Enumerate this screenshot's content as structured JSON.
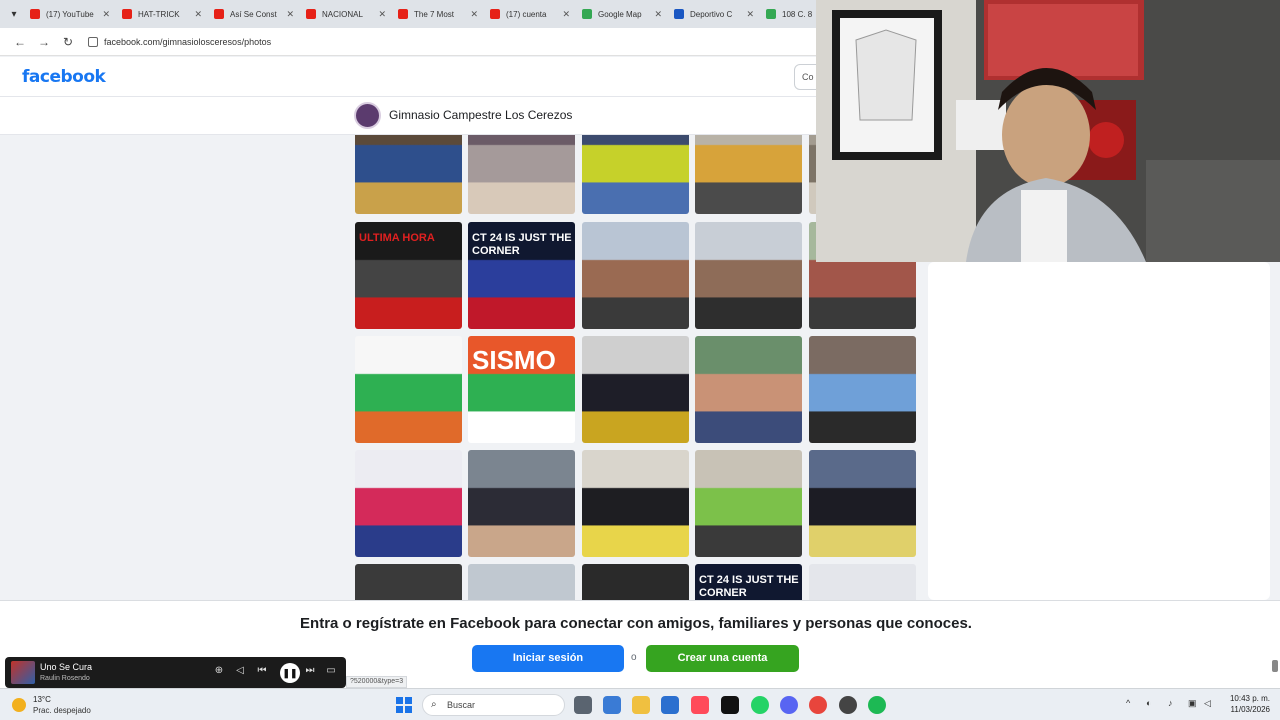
{
  "browser": {
    "tabs": [
      {
        "label": "(17) YouTube",
        "color": "#e62117"
      },
      {
        "label": "HAT-TRICK",
        "color": "#e62117"
      },
      {
        "label": "Así Se Const",
        "color": "#e62117"
      },
      {
        "label": "NACIONAL",
        "color": "#e62117"
      },
      {
        "label": "The 7 Most",
        "color": "#e62117"
      },
      {
        "label": "(17) cuenta",
        "color": "#e62117"
      },
      {
        "label": "Google Map",
        "color": "#34a853"
      },
      {
        "label": "Deportivo C",
        "color": "#1a57c2"
      },
      {
        "label": "108 C. 8",
        "color": "#34a853"
      }
    ],
    "url": "facebook.com/gimnasiolosceresos/photos",
    "status_url": "?520000&type=3"
  },
  "facebook": {
    "logo": "facebook",
    "search_placeholder": "Co",
    "page_name": "Gimnasio Campestre Los Cerezos"
  },
  "photos": [
    {
      "name": "photo-firefighter-speech",
      "colors": [
        "#5b4a3a",
        "#2e4f8c",
        "#c9a14a"
      ],
      "text": ""
    },
    {
      "name": "photo-group-bullhorn",
      "colors": [
        "#6b5b67",
        "#a59a9a",
        "#d8c9b9"
      ],
      "text": ""
    },
    {
      "name": "photo-gym-safety-vests",
      "colors": [
        "#3c4b6e",
        "#c6d12a",
        "#4a6fb0"
      ],
      "text": ""
    },
    {
      "name": "photo-firefighter-group",
      "colors": [
        "#b8b2a6",
        "#d7a33a",
        "#4b4b4b"
      ],
      "text": ""
    },
    {
      "name": "photo-partial-1",
      "colors": [
        "#a39c90",
        "#7d7467",
        "#d0c9bd"
      ],
      "text": ""
    },
    {
      "name": "photo-ultima-hora",
      "colors": [
        "#1a1a1a",
        "#444444",
        "#c81e1e"
      ],
      "text": "ULTIMA HORA"
    },
    {
      "name": "photo-act-24-corner",
      "colors": [
        "#101830",
        "#2b3e9c",
        "#c0182a"
      ],
      "text": "CT 24 IS JUST THE CORNER"
    },
    {
      "name": "photo-courtyard-students",
      "colors": [
        "#b9c5d4",
        "#9a6a52",
        "#3a3a3a"
      ],
      "text": ""
    },
    {
      "name": "photo-courtyard-formation",
      "colors": [
        "#c8ced6",
        "#8e6c58",
        "#2e2e2e"
      ],
      "text": ""
    },
    {
      "name": "photo-courtyard-red",
      "colors": [
        "#a6b89c",
        "#a2564a",
        "#3a3a3a"
      ],
      "text": ""
    },
    {
      "name": "photo-emergency-kit-list",
      "colors": [
        "#f7f7f7",
        "#2eb052",
        "#e06a2a"
      ],
      "text": ""
    },
    {
      "name": "photo-sismo-poster",
      "colors": [
        "#e8572a",
        "#2eb052",
        "#ffffff"
      ],
      "text": "SISMO"
    },
    {
      "name": "photo-graduation-row",
      "colors": [
        "#cfcfcf",
        "#1e1e28",
        "#c9a520"
      ],
      "text": ""
    },
    {
      "name": "photo-teacher-child",
      "colors": [
        "#6a8f6b",
        "#c99276",
        "#3c4c7a"
      ],
      "text": ""
    },
    {
      "name": "photo-dance-court",
      "colors": [
        "#7b6b62",
        "#6fa0d8",
        "#2a2a2a"
      ],
      "text": ""
    },
    {
      "name": "photo-jars-experiment",
      "colors": [
        "#ececf2",
        "#d42a5a",
        "#2a3c8a"
      ],
      "text": ""
    },
    {
      "name": "photo-teacher-portrait",
      "colors": [
        "#7b8590",
        "#2c2c36",
        "#c9a68a"
      ],
      "text": ""
    },
    {
      "name": "photo-diplomas-classroom",
      "colors": [
        "#d9d5cc",
        "#1e1e22",
        "#e8d54a"
      ],
      "text": ""
    },
    {
      "name": "photo-kids-green-uniform",
      "colors": [
        "#c8c2b6",
        "#7cc14a",
        "#3a3a3a"
      ],
      "text": ""
    },
    {
      "name": "photo-diplomas-suits",
      "colors": [
        "#5a6a8a",
        "#1c1c24",
        "#e0d06a"
      ],
      "text": ""
    },
    {
      "name": "photo-partial-6",
      "colors": [
        "#3a3a3a",
        "#c8a080",
        "#5a4a3a"
      ],
      "text": ""
    },
    {
      "name": "photo-partial-7",
      "colors": [
        "#c0c8d0",
        "#6a8060",
        "#3a3a3a"
      ],
      "text": ""
    },
    {
      "name": "photo-partial-8",
      "colors": [
        "#2a2a2a",
        "#c02030",
        "#ffffff"
      ],
      "text": ""
    },
    {
      "name": "photo-partial-act24",
      "colors": [
        "#101830",
        "#2b3e9c",
        "#c0182a"
      ],
      "text": "CT 24 IS JUST THE CORNER"
    },
    {
      "name": "photo-partial-loading",
      "colors": [
        "#e4e6eb",
        "#e4e6eb",
        "#e4e6eb"
      ],
      "text": ""
    }
  ],
  "banner": {
    "text": "Entra o regístrate en Facebook para conectar con amigos, familiares y personas que conoces.",
    "login_label": "Iniciar sesión",
    "or_label": "o",
    "create_label": "Crear una cuenta"
  },
  "player": {
    "title": "Uno Se Cura",
    "artist": "Raulin Rosendo"
  },
  "taskbar": {
    "temp": "13°C",
    "weather": "Prac. despejado",
    "search": "Buscar",
    "time": "10:43 p. m.",
    "date": "11/03/2026"
  }
}
